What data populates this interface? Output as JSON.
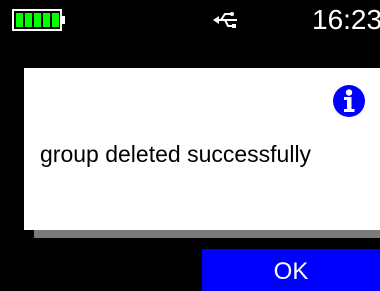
{
  "status_bar": {
    "battery_icon": "battery-full-icon",
    "battery_level": 1.0,
    "battery_color": "#00ff00",
    "usb_icon": "usb-icon",
    "time": "16:23"
  },
  "dialog": {
    "icon": "info-icon",
    "icon_color": "#0000ff",
    "message": "group deleted successfully",
    "background": "#ffffff"
  },
  "softkeys": {
    "ok_label": "OK",
    "ok_color": "#0000ff"
  }
}
